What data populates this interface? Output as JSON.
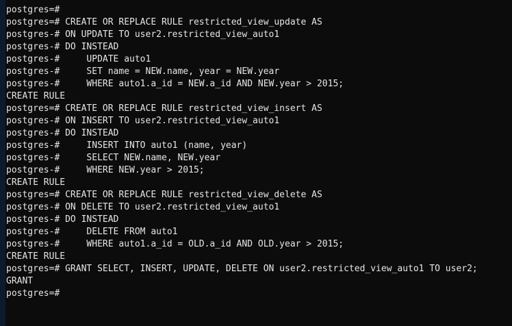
{
  "terminal": {
    "lines": [
      {
        "prompt": "postgres=#",
        "text": ""
      },
      {
        "prompt": "postgres=#",
        "text": " CREATE OR REPLACE RULE restricted_view_update AS"
      },
      {
        "prompt": "postgres-#",
        "text": " ON UPDATE TO user2.restricted_view_auto1"
      },
      {
        "prompt": "postgres-#",
        "text": " DO INSTEAD"
      },
      {
        "prompt": "postgres-#",
        "text": "     UPDATE auto1"
      },
      {
        "prompt": "postgres-#",
        "text": "     SET name = NEW.name, year = NEW.year"
      },
      {
        "prompt": "postgres-#",
        "text": "     WHERE auto1.a_id = NEW.a_id AND NEW.year > 2015;"
      },
      {
        "prompt": "",
        "text": "CREATE RULE"
      },
      {
        "prompt": "postgres=#",
        "text": " CREATE OR REPLACE RULE restricted_view_insert AS"
      },
      {
        "prompt": "postgres-#",
        "text": " ON INSERT TO user2.restricted_view_auto1"
      },
      {
        "prompt": "postgres-#",
        "text": " DO INSTEAD"
      },
      {
        "prompt": "postgres-#",
        "text": "     INSERT INTO auto1 (name, year)"
      },
      {
        "prompt": "postgres-#",
        "text": "     SELECT NEW.name, NEW.year"
      },
      {
        "prompt": "postgres-#",
        "text": "     WHERE NEW.year > 2015;"
      },
      {
        "prompt": "",
        "text": "CREATE RULE"
      },
      {
        "prompt": "postgres=#",
        "text": " CREATE OR REPLACE RULE restricted_view_delete AS"
      },
      {
        "prompt": "postgres-#",
        "text": " ON DELETE TO user2.restricted_view_auto1"
      },
      {
        "prompt": "postgres-#",
        "text": " DO INSTEAD"
      },
      {
        "prompt": "postgres-#",
        "text": "     DELETE FROM auto1"
      },
      {
        "prompt": "postgres-#",
        "text": "     WHERE auto1.a_id = OLD.a_id AND OLD.year > 2015;"
      },
      {
        "prompt": "",
        "text": "CREATE RULE"
      },
      {
        "prompt": "postgres=#",
        "text": " GRANT SELECT, INSERT, UPDATE, DELETE ON user2.restricted_view_auto1 TO user2;"
      },
      {
        "prompt": "",
        "text": "GRANT"
      },
      {
        "prompt": "postgres=#",
        "text": ""
      }
    ]
  },
  "colors": {
    "background": "#0c0c0c",
    "text": "#e6e6e6",
    "window_edge": "#0b1b2c"
  }
}
